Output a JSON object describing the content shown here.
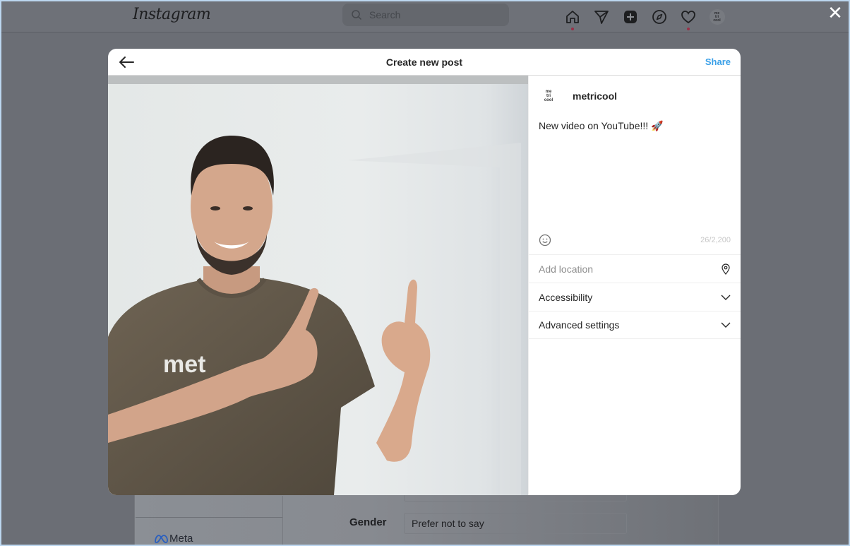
{
  "app": {
    "logo": "Instagram",
    "search": {
      "placeholder": "Search",
      "icon": "search-icon"
    },
    "nav_icons": [
      {
        "name": "home-icon",
        "notification_dot": true
      },
      {
        "name": "direct-messages-icon",
        "notification_dot": false
      },
      {
        "name": "create-post-icon",
        "notification_dot": false
      },
      {
        "name": "explore-icon",
        "notification_dot": false
      },
      {
        "name": "activity-heart-icon",
        "notification_dot": true
      },
      {
        "name": "profile-avatar",
        "notification_dot": false
      }
    ],
    "profile_avatar_text": [
      "me",
      "tri",
      "cool"
    ],
    "close_label": "✕"
  },
  "background_page": {
    "gender_label": "Gender",
    "gender_value": "Prefer not to say",
    "footer_brand": "Meta"
  },
  "modal": {
    "title": "Create new post",
    "back_icon": "arrow-left-icon",
    "share_label": "Share",
    "author": {
      "avatar_text": [
        "me",
        "tri",
        "cool"
      ],
      "username": "metricool"
    },
    "caption": "New video on YouTube!!! 🚀",
    "char_count": "26/2,200",
    "location_placeholder": "Add location",
    "rows": [
      {
        "label": "Accessibility",
        "icon": "chevron-down-icon"
      },
      {
        "label": "Advanced settings",
        "icon": "chevron-down-icon"
      }
    ],
    "photo": {
      "description": "Man in brown metricool t-shirt smiling and pointing upward",
      "shirt_text": "met"
    }
  },
  "colors": {
    "share_blue": "#3aa0e8",
    "notification_dot": "#9a3048",
    "overlay": "#6b6e75"
  }
}
